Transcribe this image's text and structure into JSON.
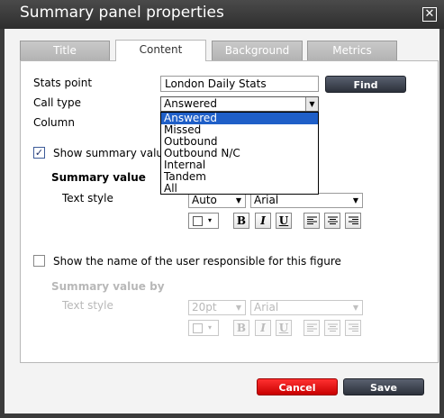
{
  "window": {
    "title": "Summary panel properties",
    "close_glyph": "✕"
  },
  "tabs": [
    {
      "label": "Title",
      "active": false
    },
    {
      "label": "Content",
      "active": true
    },
    {
      "label": "Background",
      "active": false
    },
    {
      "label": "Metrics",
      "active": false
    }
  ],
  "form": {
    "stats_point_label": "Stats point",
    "stats_point_value": "London Daily Stats",
    "find_label": "Find",
    "call_type_label": "Call type",
    "call_type_value": "Answered",
    "column_label": "Column",
    "show_summary_label": "Show summary valu",
    "show_summary_checked": true,
    "summary_value_heading": "Summary value",
    "text_style_label": "Text style",
    "size_value": "Auto",
    "font_value": "Arial",
    "show_user_label": "Show the name of the user responsible for this figure",
    "show_user_checked": false,
    "summary_by_heading": "Summary value by",
    "text_style_label_2": "Text style",
    "size_value_2": "20pt",
    "font_value_2": "Arial"
  },
  "format_buttons": {
    "bold": "B",
    "italic": "I",
    "underline": "U",
    "carrot": "▾"
  },
  "dropdown": {
    "options": [
      "Answered",
      "Missed",
      "Outbound",
      "Outbound N/C",
      "Internal",
      "Tandem",
      "All"
    ],
    "selected_index": 0
  },
  "footer": {
    "cancel_label": "Cancel",
    "save_label": "Save"
  },
  "colors": {
    "titlebar": "#3b3b3b",
    "selected_option": "#1f5fc8",
    "cancel": "#e00000",
    "save": "#3a404c"
  }
}
